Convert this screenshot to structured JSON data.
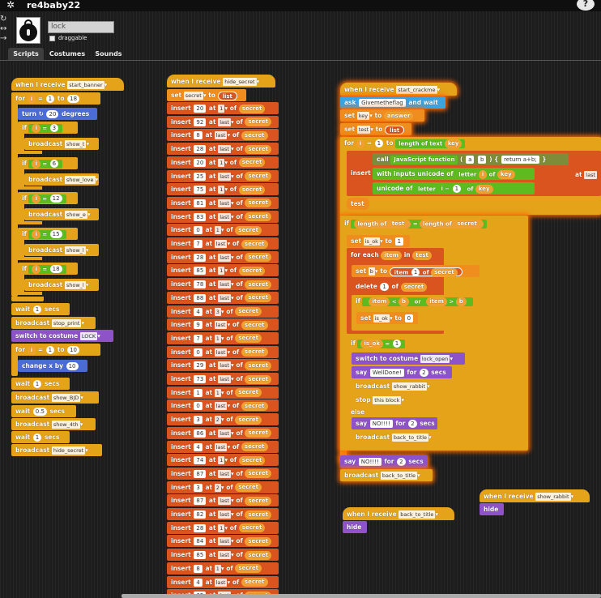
{
  "app": {
    "sprite_name": "re4baby22",
    "help": "?"
  },
  "sprite": {
    "name_value": "lock",
    "draggable_label": "draggable"
  },
  "tabs": [
    "Scripts",
    "Costumes",
    "Sounds"
  ],
  "col1": {
    "hat": "when I receive",
    "hat_msg": "start_banner",
    "for_i": "for",
    "for_from": "1",
    "for_to_word": "to",
    "for_to": "18",
    "turn": "turn",
    "turn_deg": "20",
    "degrees": "degrees",
    "ifs": [
      {
        "n": "3",
        "msg": "show_t"
      },
      {
        "n": "6",
        "msg": "show_love"
      },
      {
        "n": "12",
        "msg": "show_e"
      },
      {
        "n": "15",
        "msg": "show_l"
      },
      {
        "n": "18",
        "msg": "show_l"
      }
    ],
    "if_word": "if",
    "broadcast": "broadcast",
    "wait1": "wait",
    "wait1_v": "1",
    "secs": "secs",
    "bc_stop": "stop_print",
    "switch": "switch to costume",
    "costume": "LOCK",
    "for2_from": "1",
    "for2_to": "10",
    "change": "change x by",
    "change_v": "10",
    "wait2_v": "1",
    "bc_bjd": "show_BJD",
    "wait3_v": "0.5",
    "bc_4th": "show_4th",
    "wait4_v": "1",
    "bc_hide": "hide_secret"
  },
  "col2": {
    "hat": "when I receive",
    "hat_msg": "hide_secret",
    "set": "set",
    "var": "secret",
    "to": "to",
    "list": "list",
    "insert": "insert",
    "at": "at",
    "of": "of",
    "rows": [
      {
        "v": "20",
        "p": "1"
      },
      {
        "v": "92",
        "p": "last"
      },
      {
        "v": "8",
        "p": "last"
      },
      {
        "v": "28",
        "p": "last"
      },
      {
        "v": "20",
        "p": "1"
      },
      {
        "v": "25",
        "p": "last"
      },
      {
        "v": "75",
        "p": "1"
      },
      {
        "v": "81",
        "p": "last"
      },
      {
        "v": "83",
        "p": "last"
      },
      {
        "v": "0",
        "p": "1"
      },
      {
        "v": "7",
        "p": "last"
      },
      {
        "v": "28",
        "p": "last"
      },
      {
        "v": "85",
        "p": "1"
      },
      {
        "v": "78",
        "p": "last"
      },
      {
        "v": "88",
        "p": "last"
      },
      {
        "v": "4",
        "p": "3"
      },
      {
        "v": "9",
        "p": "last"
      },
      {
        "v": "7",
        "p": "1"
      },
      {
        "v": "0",
        "p": "last"
      },
      {
        "v": "29",
        "p": "last"
      },
      {
        "v": "73",
        "p": "last"
      },
      {
        "v": "1",
        "p": "1"
      },
      {
        "v": "0",
        "p": "last"
      },
      {
        "v": "3",
        "p": "2"
      },
      {
        "v": "86",
        "p": "last"
      },
      {
        "v": "4",
        "p": "last"
      },
      {
        "v": "74",
        "p": "1"
      },
      {
        "v": "87",
        "p": "last"
      },
      {
        "v": "3",
        "p": "2"
      },
      {
        "v": "87",
        "p": "last"
      },
      {
        "v": "82",
        "p": "last"
      },
      {
        "v": "28",
        "p": "1"
      },
      {
        "v": "84",
        "p": "last"
      },
      {
        "v": "85",
        "p": "last"
      },
      {
        "v": "8",
        "p": "1"
      },
      {
        "v": "4",
        "p": "last"
      },
      {
        "v": "65",
        "p": "last"
      }
    ]
  },
  "col3": {
    "hat": "when I receive",
    "hat_msg": "start_crackme",
    "ask": "ask",
    "ask_v": "Givemetheflag",
    "and_wait": "and wait",
    "set": "set",
    "key": "key",
    "to": "to",
    "answer": "answer",
    "test": "test",
    "list": "list",
    "for": "for",
    "i": "i",
    "from": "1",
    "length_of_text": "length of text",
    "insert": "insert",
    "call": "call",
    "js_fn": "JavaScript function",
    "a": "a",
    "b": "b",
    "ret": "return a+b;",
    "with_inputs": "with inputs",
    "unicode_of": "unicode of",
    "letter": "letter",
    "of": "of",
    "minus": "−",
    "one": "1",
    "at": "at",
    "last": "last",
    "if": "if",
    "length": "length",
    "eq": "=",
    "secret": "secret",
    "is_ok": "is_ok",
    "one_v": "1",
    "for_each": "for each",
    "item": "item",
    "in": "in",
    "set_b": "b",
    "item_word": "item",
    "delete": "delete",
    "of_word": "of",
    "lt": "<",
    "or": "or",
    "gt": ">",
    "zero": "0",
    "switch": "switch to costume",
    "lock_open": "lock_open",
    "say": "say",
    "well_done": "WellDone!",
    "for_word": "for",
    "two": "2",
    "secs": "secs",
    "broadcast": "broadcast",
    "show_rabbit": "show_rabbit",
    "stop": "stop",
    "this_block": "this block",
    "else": "else",
    "no": "NO!!!!",
    "back_to_title": "back_to_title"
  },
  "col4": {
    "hat1": "when I receive",
    "hat1_msg": "back_to_title",
    "hide1": "hide",
    "hat2": "when I receive",
    "hat2_msg": "show_rabbit",
    "hide2": "hide"
  },
  "colors": {
    "control": "#e5a31a",
    "list": "#d9541e",
    "motion": "#4a6cd4",
    "looks": "#8e53c9",
    "operators": "#5dbb20",
    "variables": "#ef8d1e"
  }
}
